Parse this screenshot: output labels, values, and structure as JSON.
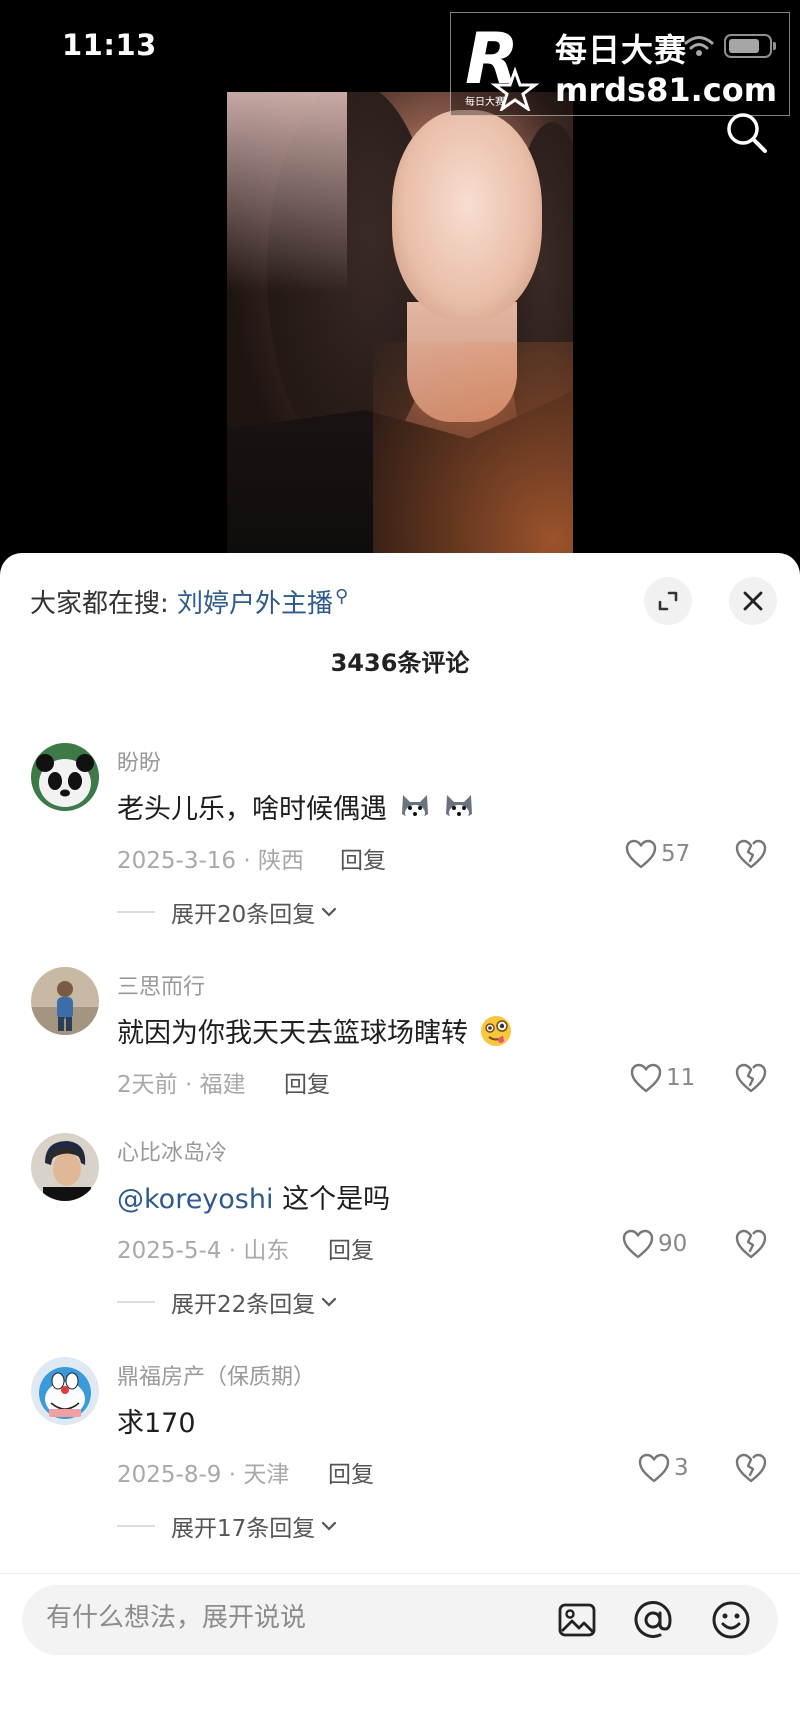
{
  "status_bar": {
    "time": "11:13"
  },
  "watermark": {
    "title": "每日大赛",
    "url": "mrds81.com",
    "logo_caption": "每日大赛"
  },
  "sheet": {
    "hot_search_prefix": "大家都在搜:",
    "hot_search_term": "刘婷户外主播",
    "comment_count": "3436条评论"
  },
  "comments": [
    {
      "user": "盼盼",
      "text": "老头儿乐，啥时候偶遇",
      "meta": "2025-3-16 · 陕西",
      "reply_label": "回复",
      "likes": "57",
      "expand_label": "展开20条回复"
    },
    {
      "user": "三思而行",
      "text": "就因为你我天天去篮球场瞎转",
      "meta": "2天前 · 福建",
      "reply_label": "回复",
      "likes": "11"
    },
    {
      "user": "心比冰岛冷",
      "mention": "@koreyoshi",
      "text": " 这个是吗",
      "meta": "2025-5-4 · 山东",
      "reply_label": "回复",
      "likes": "90",
      "expand_label": "展开22条回复"
    },
    {
      "user": "鼎福房产（保质期）",
      "text": "求170",
      "meta": "2025-8-9 · 天津",
      "reply_label": "回复",
      "likes": "3",
      "expand_label": "展开17条回复"
    }
  ],
  "input_bar": {
    "placeholder": "有什么想法，展开说说"
  },
  "icons": [
    "wifi-icon",
    "battery-icon",
    "search-icon",
    "expand-icon",
    "close-icon",
    "heart-icon",
    "broken-heart-icon",
    "chevron-down-icon",
    "image-icon",
    "at-icon",
    "emoji-icon"
  ],
  "colors": {
    "link": "#2f5b8c",
    "sheet_bg": "#ffffff",
    "video_bg": "#000000"
  }
}
